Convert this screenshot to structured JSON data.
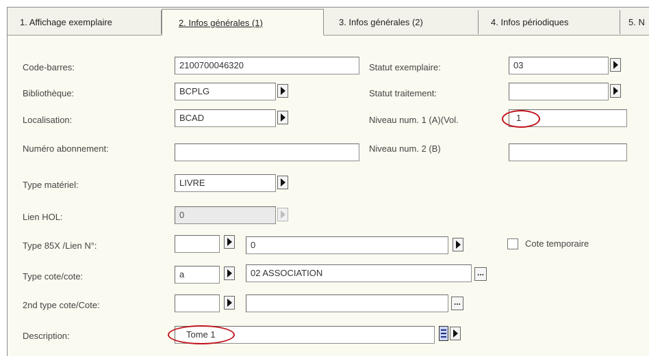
{
  "tabs": [
    {
      "label": "1. Affichage exemplaire"
    },
    {
      "label": "2. Infos générales (1)"
    },
    {
      "label": "3. Infos générales (2)"
    },
    {
      "label": "4. Infos périodiques"
    },
    {
      "label": "5. N"
    }
  ],
  "form": {
    "code_barres": {
      "label": "Code-barres:",
      "value": "2100700046320"
    },
    "bibliotheque": {
      "label": "Bibliothèque:",
      "value": "BCPLG"
    },
    "localisation": {
      "label": "Localisation:",
      "value": "BCAD"
    },
    "numero_abonnement": {
      "label": "Numéro abonnement:",
      "value": ""
    },
    "type_materiel": {
      "label": "Type matériel:",
      "value": "LIVRE"
    },
    "lien_hol": {
      "label": "Lien HOL:",
      "value": "0"
    },
    "type_85x": {
      "label": "Type 85X /Lien N°:",
      "type_value": "",
      "lien_value": "0"
    },
    "type_cote": {
      "label": "Type cote/cote:",
      "type_value": "a",
      "cote_value": "02 ASSOCIATION"
    },
    "type_cote_2": {
      "label": "2nd type cote/Cote:",
      "type_value": "",
      "cote_value": ""
    },
    "description": {
      "label": "Description:",
      "value": "Tome 1"
    },
    "statut_exemplaire": {
      "label": "Statut exemplaire:",
      "value": "03"
    },
    "statut_traitement": {
      "label": "Statut traitement:",
      "value": ""
    },
    "niveau_1": {
      "label": "Niveau num. 1 (A)(Vol.",
      "value": "1"
    },
    "niveau_2": {
      "label": "Niveau num. 2  (B)",
      "value": ""
    },
    "cote_temporaire": {
      "label": "Cote temporaire",
      "checked": false
    },
    "ellipsis": "..."
  },
  "annotation_color": "#c0141c"
}
